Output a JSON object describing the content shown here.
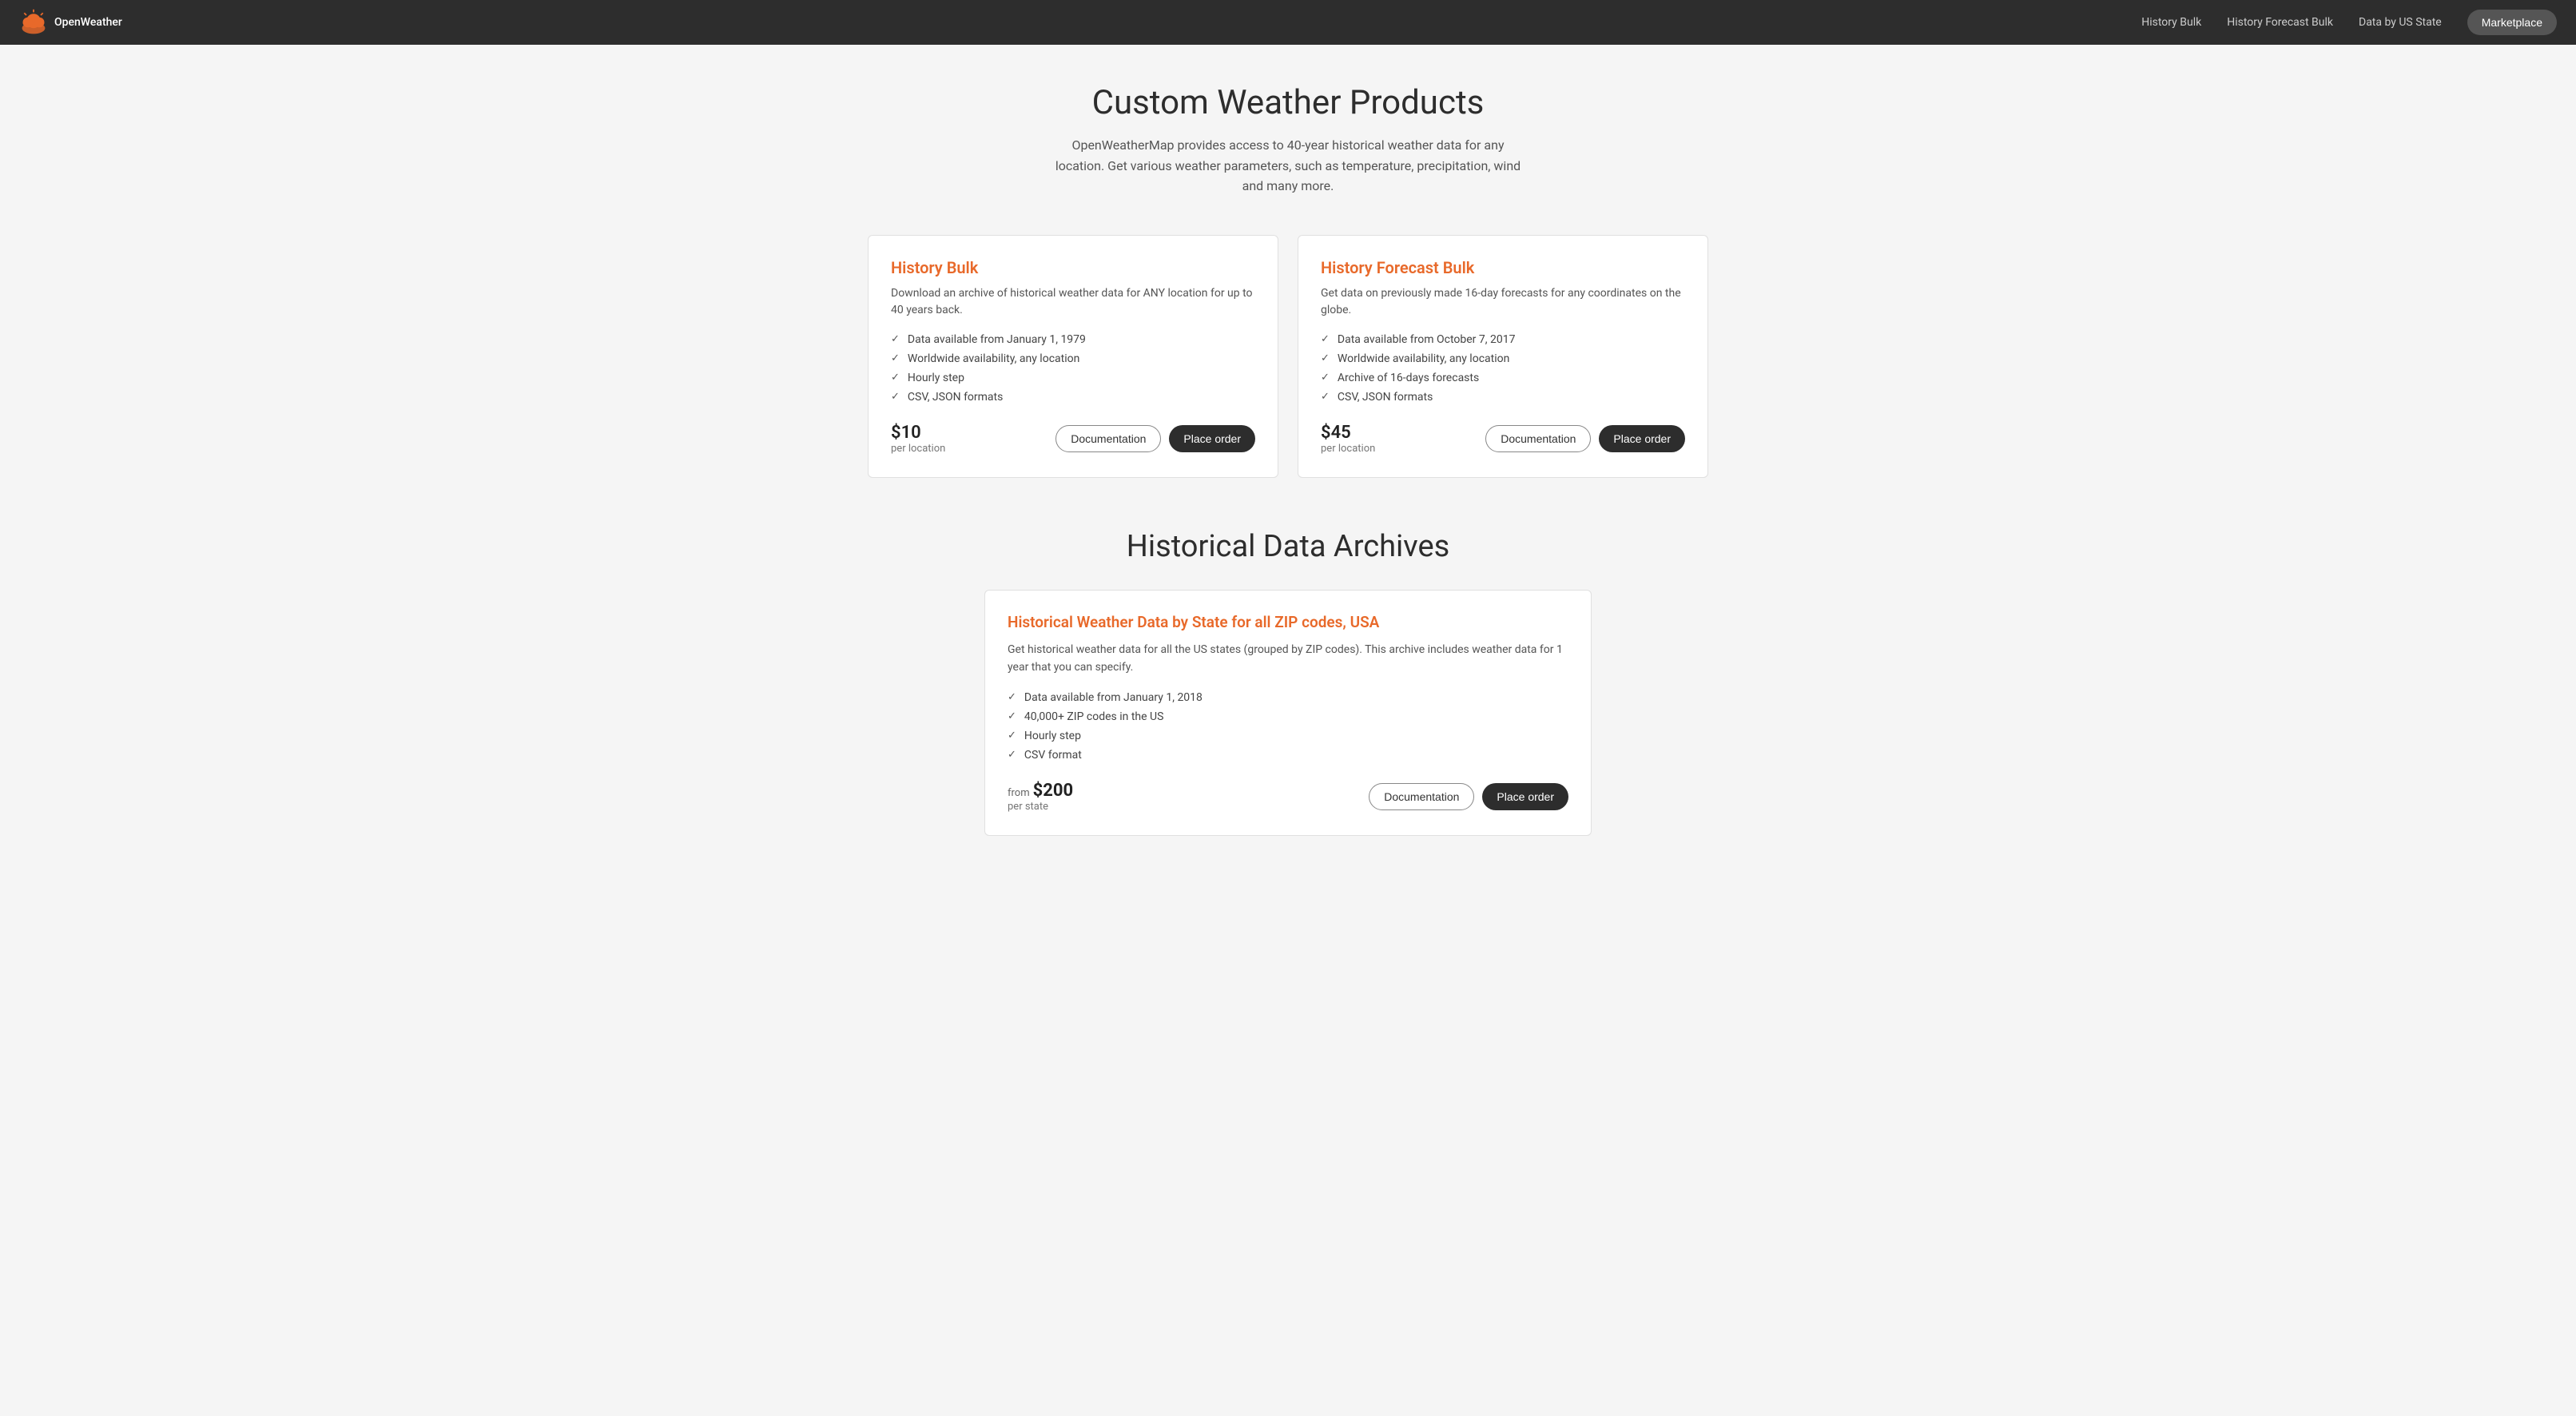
{
  "nav": {
    "logo_text": "OpenWeather",
    "links": [
      {
        "id": "history-bulk",
        "label": "History Bulk"
      },
      {
        "id": "history-forecast-bulk",
        "label": "History Forecast Bulk"
      },
      {
        "id": "data-by-us-state",
        "label": "Data by US State"
      }
    ],
    "marketplace_label": "Marketplace"
  },
  "hero": {
    "title": "Custom Weather Products",
    "subtitle": "OpenWeatherMap provides access to 40-year historical weather data for any location. Get various weather parameters, such as temperature, precipitation, wind and many more."
  },
  "products": [
    {
      "id": "history-bulk",
      "title": "History Bulk",
      "description": "Download an archive of historical weather data for ANY location for up to 40 years back.",
      "features": [
        "Data available from January 1, 1979",
        "Worldwide availability, any location",
        "Hourly step",
        "CSV, JSON formats"
      ],
      "price": "$10",
      "price_from": false,
      "price_unit": "per location",
      "btn_docs": "Documentation",
      "btn_order": "Place order"
    },
    {
      "id": "history-forecast-bulk",
      "title": "History Forecast Bulk",
      "description": "Get data on previously made 16-day forecasts for any coordinates on the globe.",
      "features": [
        "Data available from October 7, 2017",
        "Worldwide availability, any location",
        "Archive of 16-days forecasts",
        "CSV, JSON formats"
      ],
      "price": "$45",
      "price_from": false,
      "price_unit": "per location",
      "btn_docs": "Documentation",
      "btn_order": "Place order"
    }
  ],
  "archives": {
    "section_title": "Historical Data Archives",
    "card": {
      "title": "Historical Weather Data by State for all ZIP codes, USA",
      "description": "Get historical weather data for all the US states (grouped by ZIP codes). This archive includes weather data for 1 year that you can specify.",
      "features": [
        "Data available from January 1, 2018",
        "40,000+ ZIP codes in the US",
        "Hourly step",
        "CSV format"
      ],
      "price_from_label": "from",
      "price": "$200",
      "price_unit": "per state",
      "btn_docs": "Documentation",
      "btn_order": "Place order"
    }
  }
}
